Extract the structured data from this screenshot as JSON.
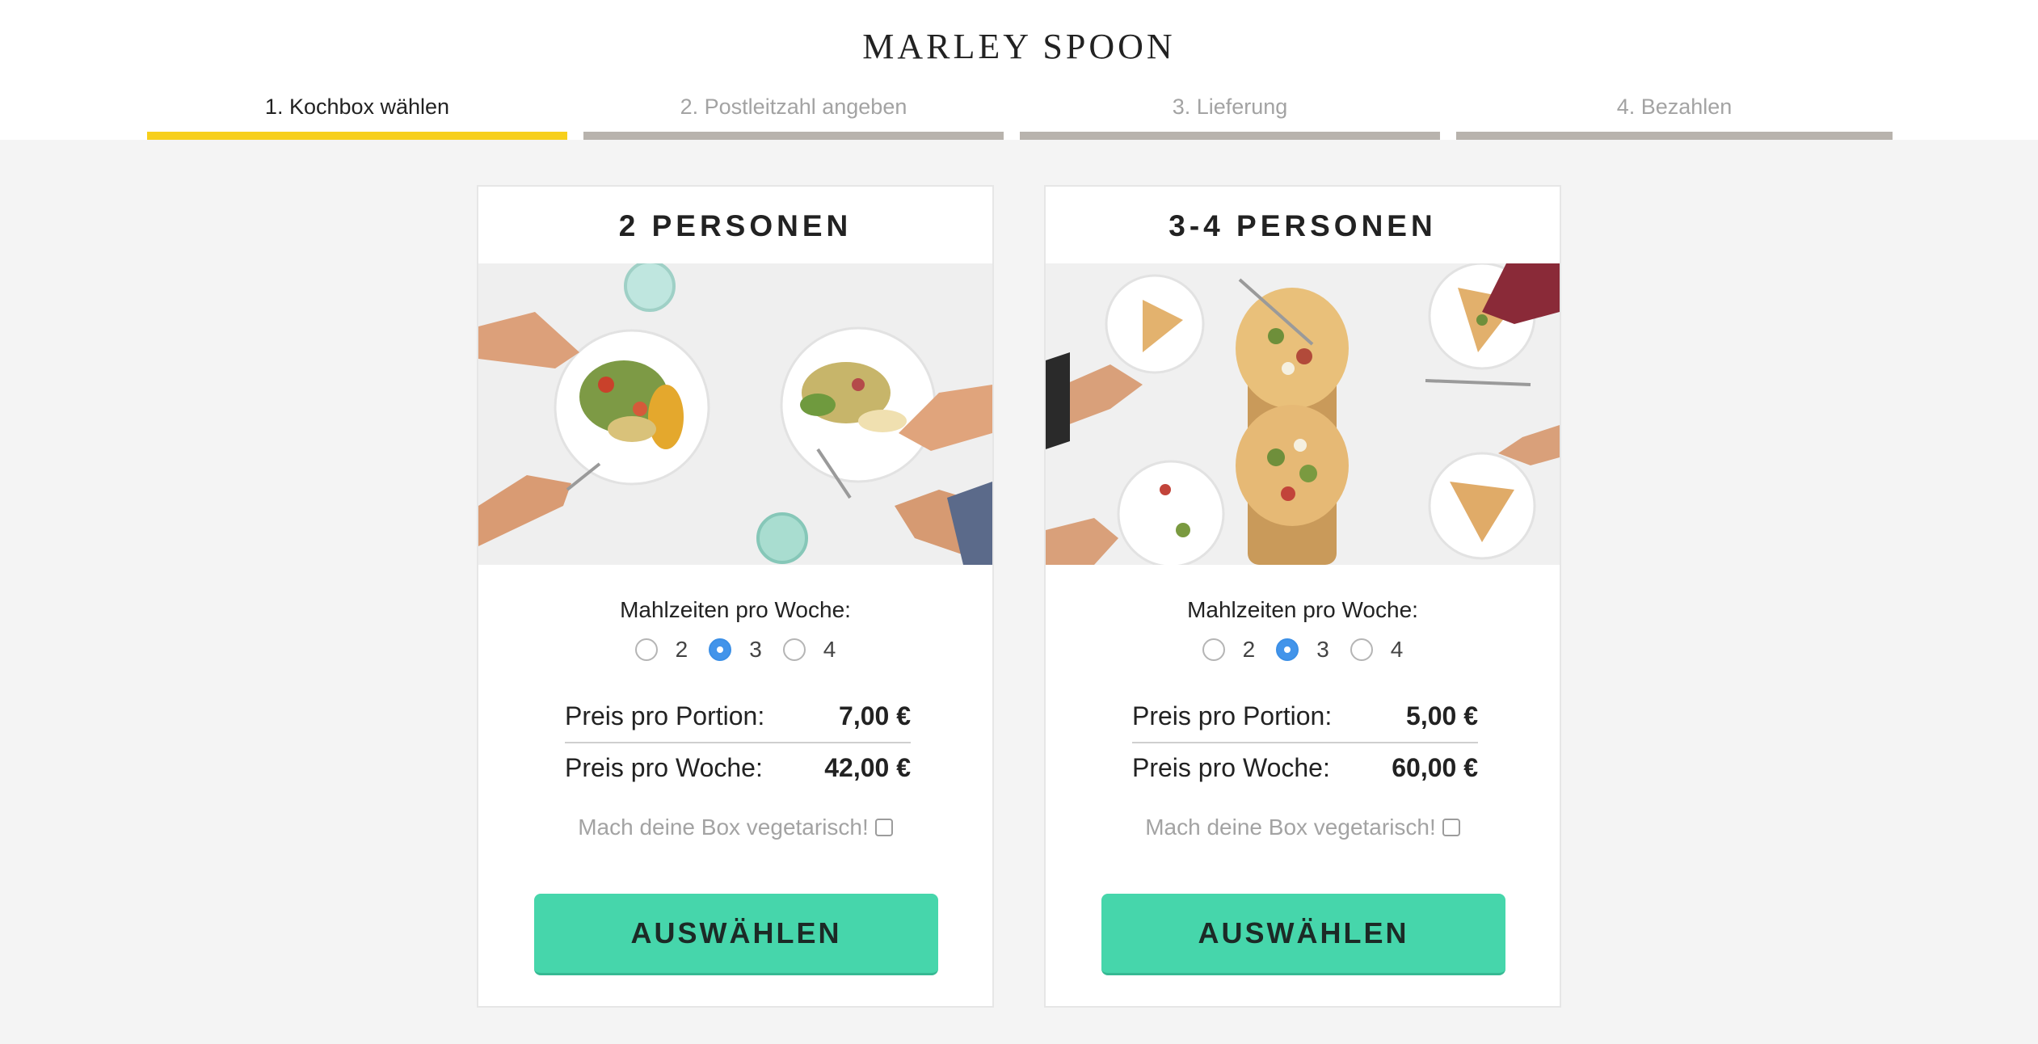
{
  "brand": {
    "logo_text": "MARLEY SPOON"
  },
  "steps": [
    {
      "label": "1. Kochbox wählen",
      "active": true
    },
    {
      "label": "2. Postleitzahl angeben",
      "active": false
    },
    {
      "label": "3. Lieferung",
      "active": false
    },
    {
      "label": "4. Bezahlen",
      "active": false
    }
  ],
  "colors": {
    "accent_yellow": "#f7cf1c",
    "button_green": "#46d6ab",
    "radio_blue": "#4294ea",
    "step_inactive": "#b8b3ad"
  },
  "cards": [
    {
      "title": "2 PERSONEN",
      "meals_label": "Mahlzeiten pro Woche:",
      "options": [
        "2",
        "3",
        "4"
      ],
      "selected": "3",
      "portion_label": "Preis pro Portion:",
      "portion_price": "7,00 €",
      "week_label": "Preis pro Woche:",
      "week_price": "42,00 €",
      "veg_label": "Mach deine Box vegetarisch!",
      "button_label": "AUSWÄHLEN"
    },
    {
      "title": "3-4 PERSONEN",
      "meals_label": "Mahlzeiten pro Woche:",
      "options": [
        "2",
        "3",
        "4"
      ],
      "selected": "3",
      "portion_label": "Preis pro Portion:",
      "portion_price": "5,00 €",
      "week_label": "Preis pro Woche:",
      "week_price": "60,00 €",
      "veg_label": "Mach deine Box vegetarisch!",
      "button_label": "AUSWÄHLEN"
    }
  ]
}
